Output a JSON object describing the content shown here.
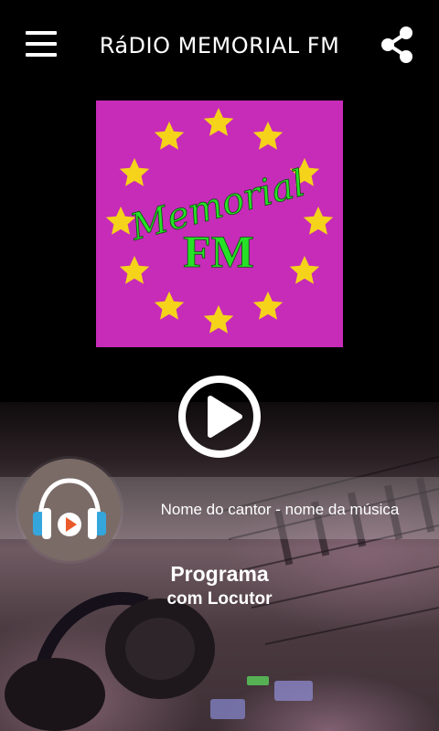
{
  "header": {
    "title": "RáDIO MEMORIAL FM",
    "menu_icon": "hamburger-menu-icon",
    "share_icon": "share-icon"
  },
  "logo": {
    "line1": "Memorial",
    "line2": "FM",
    "background": "#c62cb8",
    "star_color": "#f5d31a",
    "text_color": "#27e127"
  },
  "player": {
    "play_icon": "play-icon",
    "now_playing": "Nome do cantor - nome da música",
    "program": "Programa",
    "host": "com Locutor",
    "headphones_icon": "headphones-play-icon"
  }
}
